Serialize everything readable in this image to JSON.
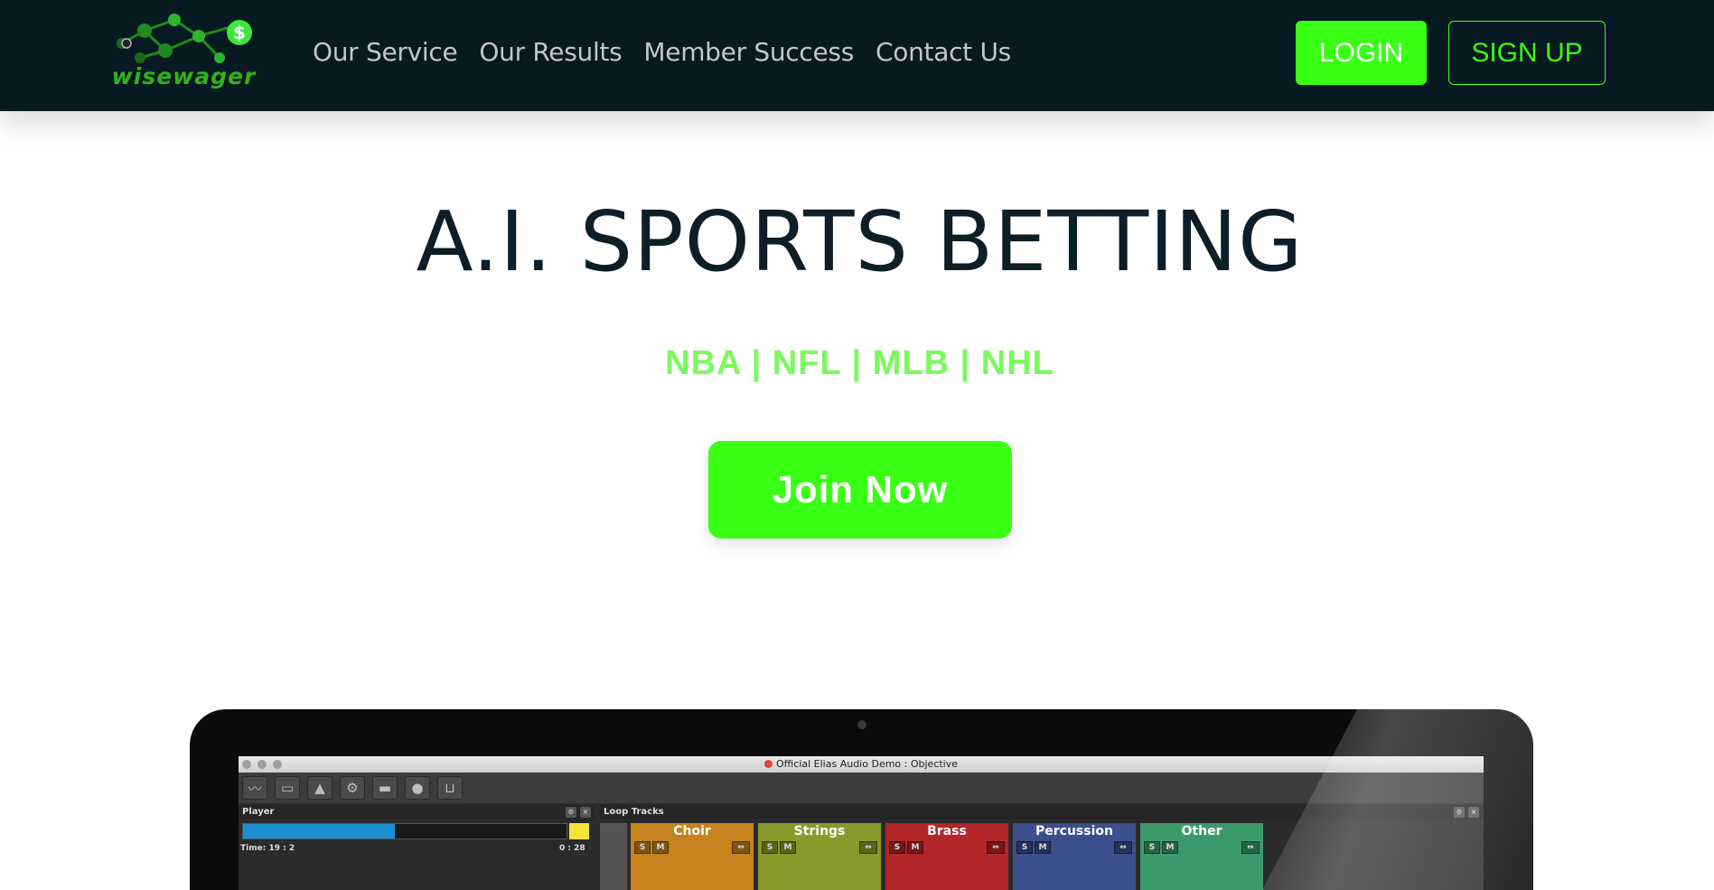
{
  "header": {
    "logo_text": "wisewager",
    "nav": [
      {
        "label": "Our Service"
      },
      {
        "label": "Our Results"
      },
      {
        "label": "Member Success"
      },
      {
        "label": "Contact Us"
      }
    ],
    "login_label": "LOGIN",
    "signup_label": "SIGN UP"
  },
  "hero": {
    "title": "A.I. SPORTS BETTING",
    "leagues": "NBA | NFL | MLB | NHL",
    "cta_label": "Join Now"
  },
  "mockup": {
    "window_title": "Official Elias Audio Demo : Objective",
    "player_title": "Player",
    "loop_tracks_title": "Loop Tracks",
    "player_progress": 0.47,
    "time_left": "Time: 19 : 2",
    "time_right": "0 : 28",
    "tracks": [
      {
        "name": "Choir",
        "color": "#c5821d"
      },
      {
        "name": "Strings",
        "color": "#8a9a2a"
      },
      {
        "name": "Brass",
        "color": "#b2262a"
      },
      {
        "name": "Percussion",
        "color": "#3d4e8c"
      },
      {
        "name": "Other",
        "color": "#3c9a6a"
      }
    ],
    "tool_icons": [
      "wave-icon",
      "save-icon",
      "rocket-icon",
      "gear-icon",
      "export-icon",
      "user-icon",
      "cart-icon"
    ],
    "track_button_s": "S",
    "track_button_m": "M"
  },
  "colors": {
    "header_bg": "#071921",
    "accent_green": "#39ff14",
    "leagues_green": "#7cf95e",
    "title_dark": "#0c1e28"
  }
}
